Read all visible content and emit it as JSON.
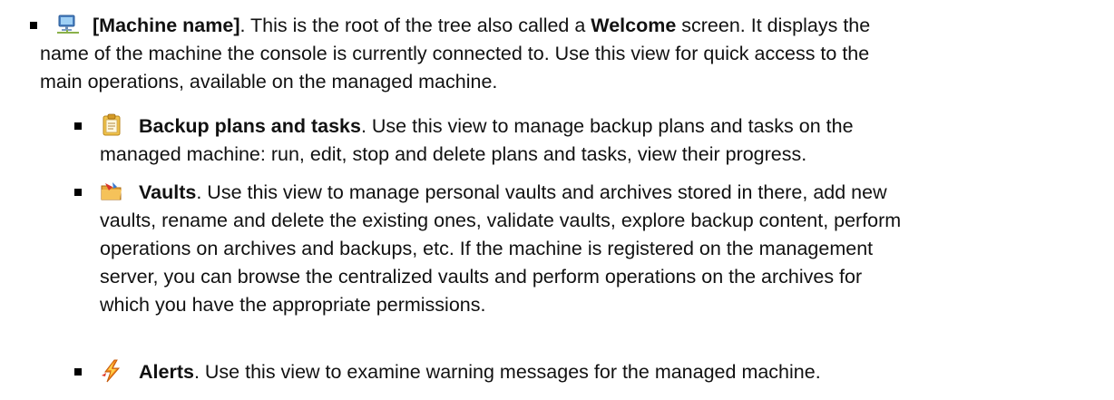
{
  "items": {
    "machine": {
      "icon": "computer-network-icon",
      "line1_title": "[Machine name]",
      "line1_a": ". This is the root of the tree also called a ",
      "line1_b": "Welcome",
      "line1_c": " screen. It displays the",
      "line2": "name of the machine the console is currently connected to. Use this view for quick access to the",
      "line3": "main operations, available on the managed machine."
    },
    "backup": {
      "icon": "clipboard-icon",
      "title": "Backup plans and tasks",
      "line1_rest": ". Use this view to manage backup plans and tasks on the",
      "line2": "managed machine: run, edit, stop and delete plans and tasks, view their progress."
    },
    "vaults": {
      "icon": "folder-vault-icon",
      "title": "Vaults",
      "line1_rest": ". Use this view to manage personal vaults and archives stored in there, add new",
      "line2": "vaults, rename and delete the existing ones, validate vaults, explore backup content, perform",
      "line3": "operations on archives and backups, etc. If the machine is registered on the management",
      "line4": "server, you can browse the centralized vaults and perform operations on the archives for",
      "line5": "which you have the appropriate permissions."
    },
    "alerts": {
      "icon": "lightning-alert-icon",
      "title": "Alerts",
      "line1_rest": ". Use this view to examine warning messages for the managed machine."
    }
  }
}
